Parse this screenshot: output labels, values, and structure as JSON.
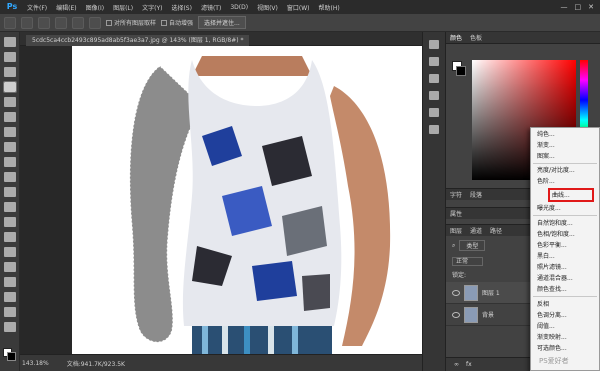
{
  "app": {
    "logo": "Ps",
    "title": "Adobe Photoshop"
  },
  "menubar": {
    "items": [
      "文件(F)",
      "编辑(E)",
      "图像(I)",
      "图层(L)",
      "文字(Y)",
      "选择(S)",
      "滤镜(T)",
      "3D(D)",
      "视图(V)",
      "窗口(W)",
      "帮助(H)"
    ],
    "window_controls": [
      "—",
      "□",
      "✕"
    ]
  },
  "options_bar": {
    "sample_all_layers": "对所有图层取样",
    "auto_enhance": "自动增强",
    "select_and_mask": "选择并遮住..."
  },
  "document": {
    "tab_label": "5cdc5ca4ccb2493c895ad8ab5f3ae3a7.jpg @ 143% (图层 1, RGB/8#) *",
    "zoom": "143.18%",
    "doc_size": "文档:941.7K/923.5K"
  },
  "panels": {
    "color_tabs": [
      "颜色",
      "色板"
    ],
    "mid_tabs": [
      "字符",
      "段落"
    ],
    "properties_label": "属性",
    "layers_tabs": [
      "图层",
      "通道",
      "路径"
    ],
    "filter_kind": "类型",
    "blend_mode": "正常",
    "lock_label": "锁定:",
    "layers": [
      {
        "name": "图层 1"
      },
      {
        "name": "背景"
      }
    ]
  },
  "adjustment_menu": {
    "items": [
      "纯色...",
      "渐变...",
      "图案...",
      "亮度/对比度...",
      "色阶...",
      "曲线...",
      "曝光度...",
      "自然饱和度...",
      "色相/饱和度...",
      "色彩平衡...",
      "黑白...",
      "照片滤镜...",
      "通道混合器...",
      "颜色查找...",
      "反相",
      "色调分离...",
      "阈值...",
      "渐变映射...",
      "可选颜色..."
    ],
    "highlighted": "曲线..."
  },
  "watermark": "PS爱好者",
  "colors": {
    "accent": "#31a8ff",
    "highlight_border": "#e01919",
    "menu_bg": "#f3f3f3",
    "panel_bg": "#424242"
  }
}
